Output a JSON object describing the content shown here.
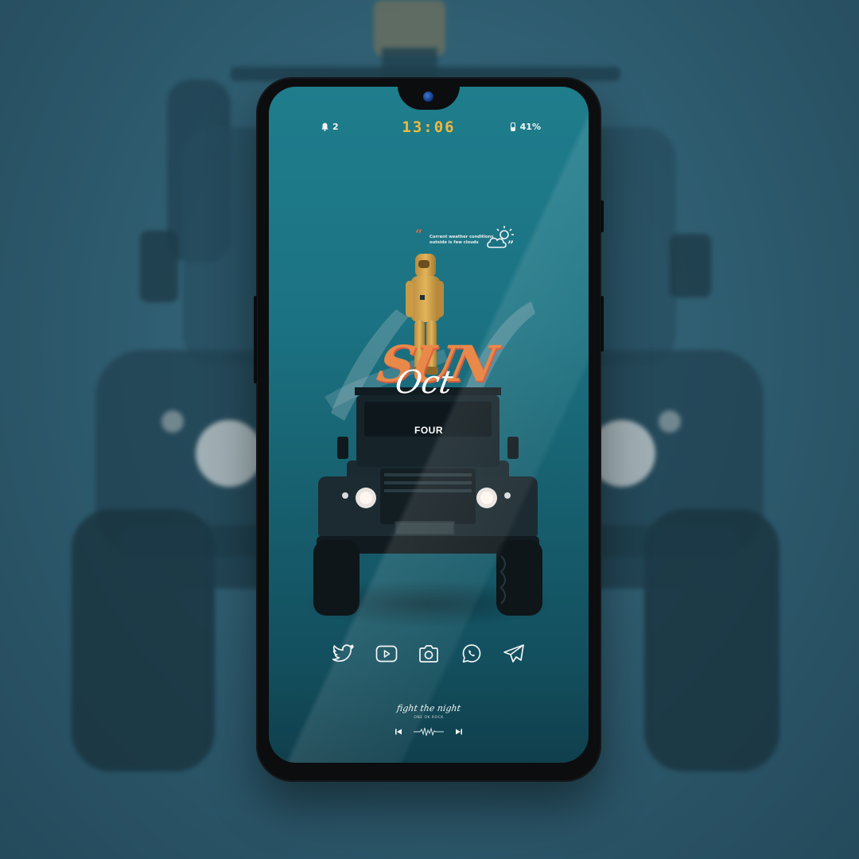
{
  "status_bar": {
    "notification_count": "2",
    "time": "13:06",
    "battery_percent": "41%",
    "icons": [
      "bell-icon",
      "battery-icon"
    ]
  },
  "weather_widget": {
    "text": "Current weather conditions outside is few clouds",
    "icon": "partly-cloudy-icon"
  },
  "date_widget": {
    "day": "SUN",
    "month": "Oct",
    "day_of_month": "FOUR"
  },
  "dock": {
    "apps": [
      {
        "name": "twitter",
        "icon": "twitter-icon"
      },
      {
        "name": "youtube",
        "icon": "youtube-icon"
      },
      {
        "name": "camera",
        "icon": "camera-icon"
      },
      {
        "name": "whatsapp",
        "icon": "whatsapp-icon"
      },
      {
        "name": "telegram",
        "icon": "telegram-icon"
      }
    ]
  },
  "music_widget": {
    "song": "fight the night",
    "artist": "ONE OK ROCK",
    "icons": [
      "previous-icon",
      "waveform-icon",
      "next-icon"
    ]
  },
  "colors": {
    "clock": "#f2b93a",
    "screen_teal": "#1b7282",
    "day_orange": "#e8894a",
    "quote_red": "#e06b45"
  }
}
